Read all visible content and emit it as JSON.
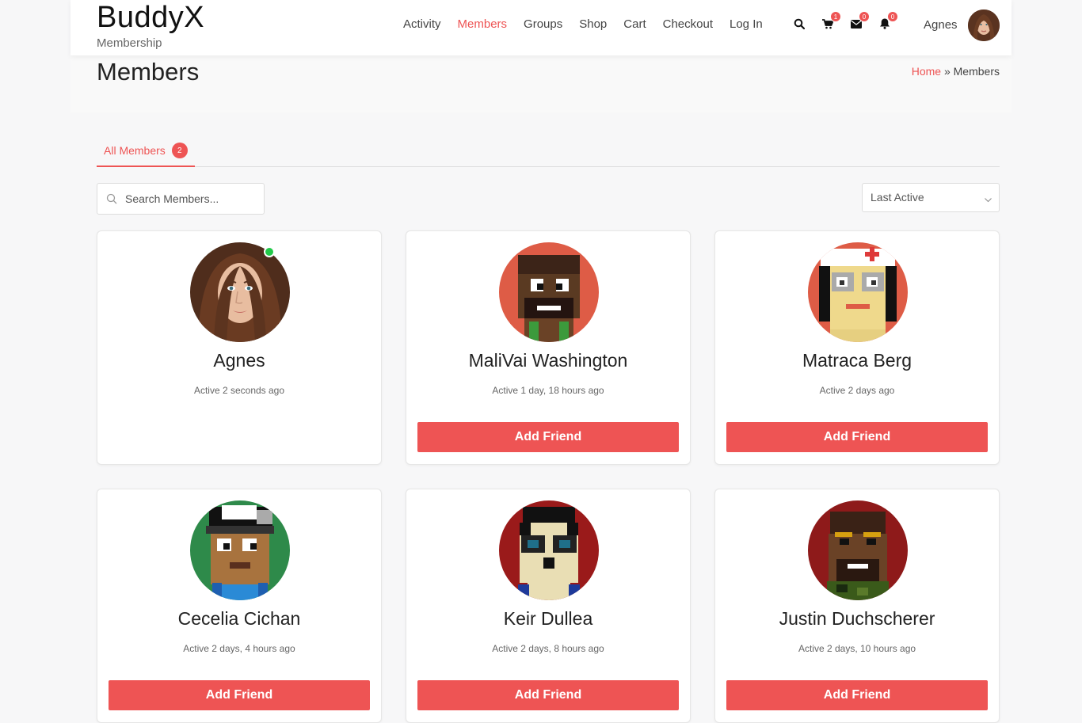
{
  "brand": {
    "title": "BuddyX",
    "subtitle": "Membership"
  },
  "nav": [
    "Activity",
    "Members",
    "Groups",
    "Shop",
    "Cart",
    "Checkout",
    "Log In"
  ],
  "nav_active": "Members",
  "icons": [
    {
      "name": "search-icon",
      "badge": ""
    },
    {
      "name": "cart-icon",
      "badge": "1"
    },
    {
      "name": "envelope-icon",
      "badge": "0"
    },
    {
      "name": "bell-icon",
      "badge": "0"
    }
  ],
  "user": {
    "name": "Agnes"
  },
  "page": {
    "title": "Members"
  },
  "breadcrumb": {
    "home": "Home",
    "sep": "»",
    "current": "Members"
  },
  "tab": {
    "label": "All Members",
    "count": "2"
  },
  "search": {
    "placeholder": "Search Members..."
  },
  "sort": {
    "value": "Last Active"
  },
  "accent": "#ee5454",
  "members": [
    {
      "name": "Agnes",
      "active": "Active 2 seconds ago",
      "online": true,
      "button": ""
    },
    {
      "name": "MaliVai Washington",
      "active": "Active 1 day, 18 hours ago",
      "online": false,
      "button": "Add Friend"
    },
    {
      "name": "Matraca Berg",
      "active": "Active 2 days ago",
      "online": false,
      "button": "Add Friend"
    },
    {
      "name": "Cecelia Cichan",
      "active": "Active 2 days, 4 hours ago",
      "online": false,
      "button": "Add Friend"
    },
    {
      "name": "Keir Dullea",
      "active": "Active 2 days, 8 hours ago",
      "online": false,
      "button": "Add Friend"
    },
    {
      "name": "Justin Duchscherer",
      "active": "Active 2 days, 10 hours ago",
      "online": false,
      "button": "Add Friend"
    }
  ]
}
